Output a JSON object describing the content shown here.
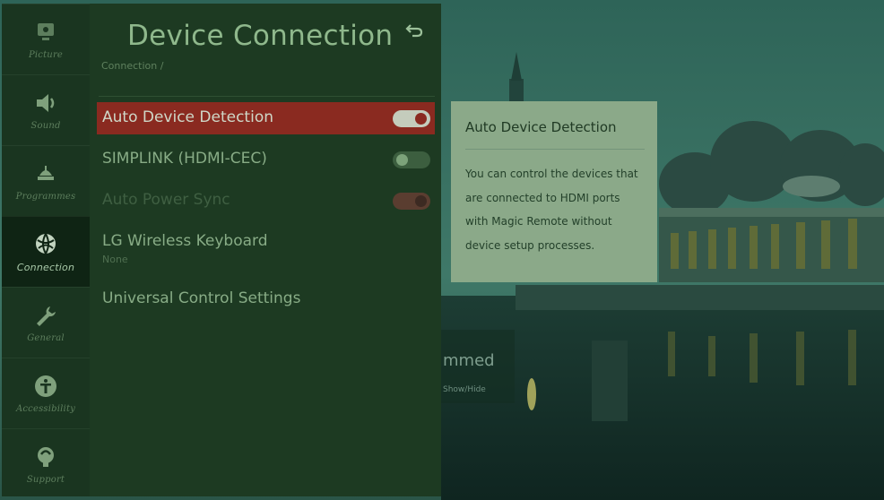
{
  "rail": {
    "items": [
      {
        "label": "Picture",
        "icon": "picture-icon"
      },
      {
        "label": "Sound",
        "icon": "speaker-icon"
      },
      {
        "label": "Programmes",
        "icon": "antenna-icon"
      },
      {
        "label": "Connection",
        "icon": "connection-globe-icon",
        "active": true
      },
      {
        "label": "General",
        "icon": "wrench-icon"
      },
      {
        "label": "Accessibility",
        "icon": "accessibility-icon"
      },
      {
        "label": "Support",
        "icon": "support-icon"
      }
    ]
  },
  "panel": {
    "title": "Device Connection",
    "breadcrumb": "Connection /",
    "back_icon": "back-arrow-icon",
    "rows": [
      {
        "label": "Auto Device Detection",
        "toggle": "on",
        "highlighted": true
      },
      {
        "label": "SIMPLINK (HDMI-CEC)",
        "toggle": "off"
      },
      {
        "label": "Auto Power Sync",
        "toggle": "on",
        "disabled": true
      },
      {
        "label": "LG Wireless Keyboard",
        "sub": "None"
      },
      {
        "label": "Universal Control Settings"
      }
    ]
  },
  "tooltip": {
    "title": "Auto Device Detection",
    "body": "You can control the devices that are connected to HDMI ports with Magic Remote without device setup processes."
  },
  "background": {
    "partial_text": "mmed",
    "partial_sub": "Show/Hide"
  },
  "colors": {
    "highlight": "#8a2a20",
    "panel": "#1d3a22",
    "rail": "#1a3520",
    "tooltip": "#8ba989"
  }
}
